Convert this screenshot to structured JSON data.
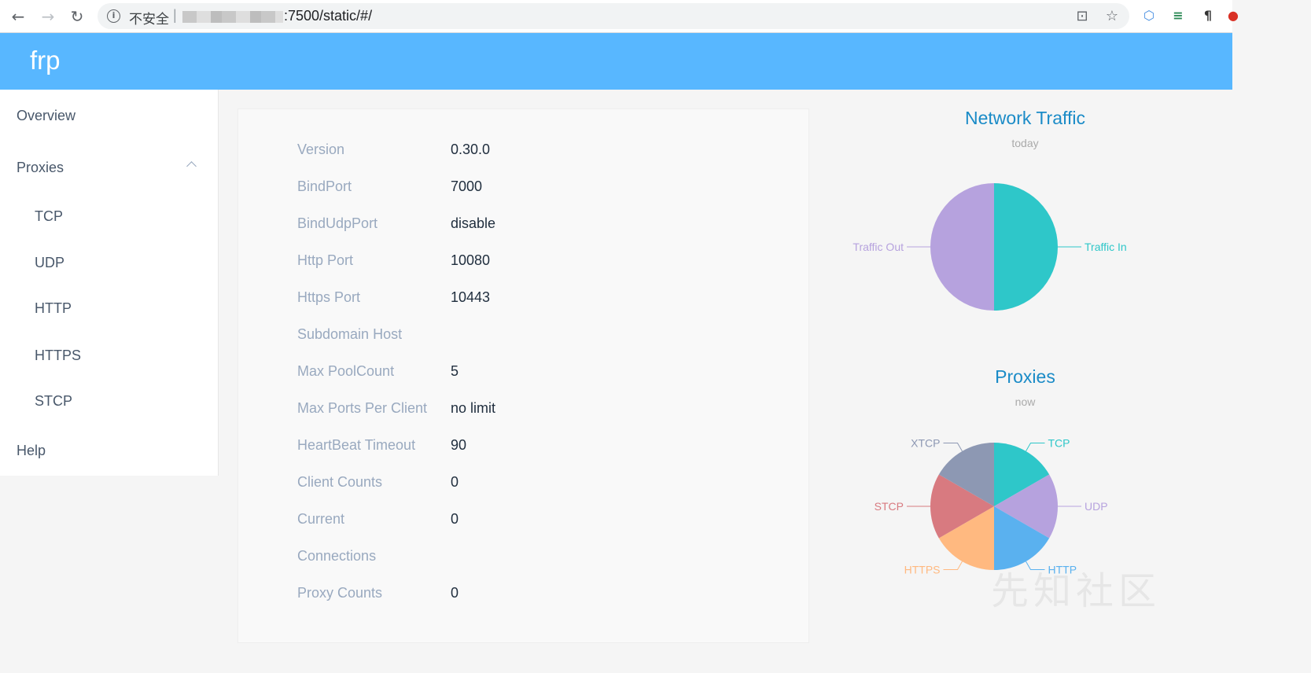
{
  "browser": {
    "security_label": "不安全",
    "url_path": ":7500/static/#/"
  },
  "app": {
    "brand": "frp"
  },
  "sidebar": {
    "overview": "Overview",
    "proxies": "Proxies",
    "sub_items": [
      "TCP",
      "UDP",
      "HTTP",
      "HTTPS",
      "STCP"
    ],
    "help": "Help"
  },
  "server_info": [
    {
      "label": "Version",
      "value": "0.30.0"
    },
    {
      "label": "BindPort",
      "value": "7000"
    },
    {
      "label": "BindUdpPort",
      "value": "disable"
    },
    {
      "label": "Http Port",
      "value": "10080"
    },
    {
      "label": "Https Port",
      "value": "10443"
    },
    {
      "label": "Subdomain Host",
      "value": ""
    },
    {
      "label": "Max PoolCount",
      "value": "5"
    },
    {
      "label": "Max Ports Per Client",
      "value": "no limit"
    },
    {
      "label": "HeartBeat Timeout",
      "value": "90"
    },
    {
      "label": "Client Counts",
      "value": "0"
    },
    {
      "label": "Current",
      "value": "0"
    },
    {
      "label": "Connections",
      "value": ""
    },
    {
      "label": "Proxy Counts",
      "value": "0"
    }
  ],
  "colors": {
    "header": "#58b7ff",
    "teal": "#2ec7c9",
    "purple": "#b6a2de",
    "blue": "#5ab1ef",
    "orange": "#ffb980",
    "red": "#d87a80",
    "slate": "#8d98b3"
  },
  "chart_data": [
    {
      "type": "pie",
      "title": "Network Traffic",
      "subtitle": "today",
      "categories": [
        "Traffic In",
        "Traffic Out"
      ],
      "values": [
        50,
        50
      ],
      "colors": [
        "#2ec7c9",
        "#b6a2de"
      ]
    },
    {
      "type": "pie",
      "title": "Proxies",
      "subtitle": "now",
      "categories": [
        "TCP",
        "UDP",
        "HTTP",
        "HTTPS",
        "STCP",
        "XTCP"
      ],
      "values": [
        1,
        1,
        1,
        1,
        1,
        1
      ],
      "colors": [
        "#2ec7c9",
        "#b6a2de",
        "#5ab1ef",
        "#ffb980",
        "#d87a80",
        "#8d98b3"
      ]
    }
  ],
  "watermark": "先知社区"
}
